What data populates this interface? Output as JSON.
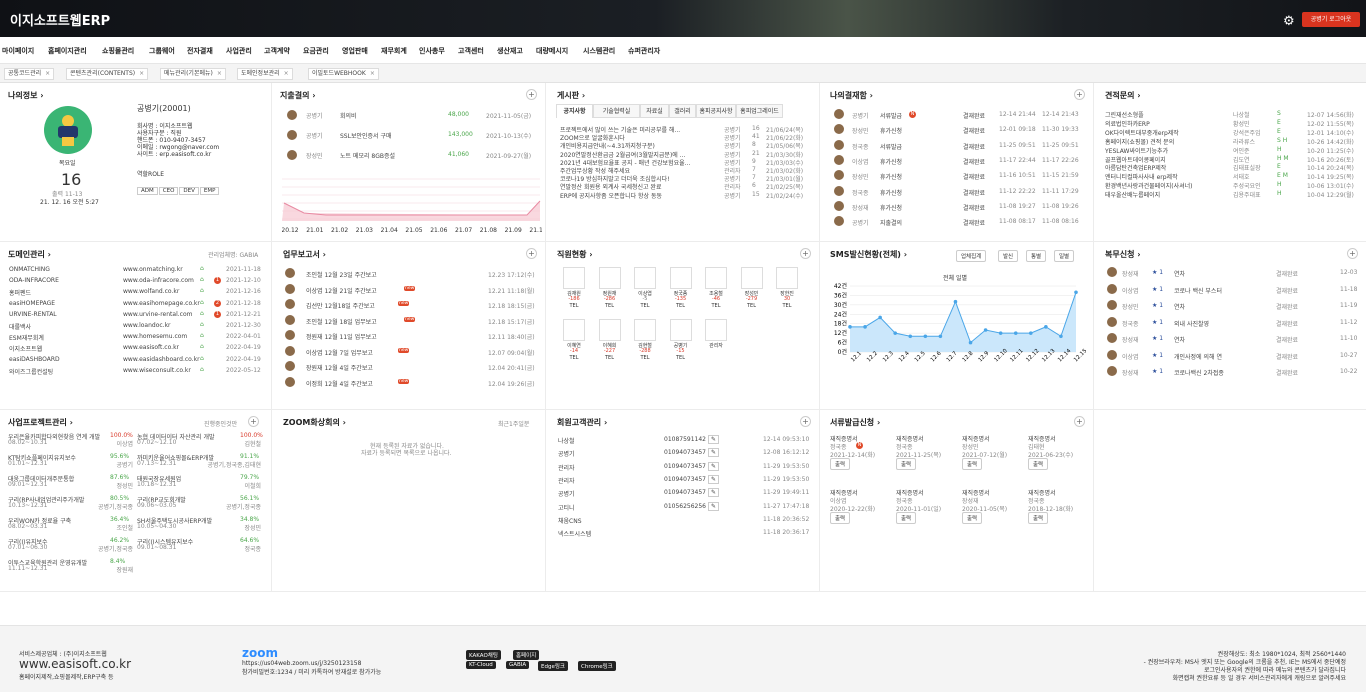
{
  "header": {
    "logo": "이지소프트웹ERP",
    "logout": "공병기 로그아웃"
  },
  "menu": [
    "마이페이지",
    "홈페이지관리",
    "쇼핑몰관리",
    "그룹웨어",
    "전자결재",
    "사업관리",
    "고객계약",
    "요금관리",
    "영업판매",
    "재무회계",
    "인사총무",
    "고객센터",
    "생산재고",
    "대량메시지",
    "시스템관리",
    "슈퍼관리자"
  ],
  "tabs": [
    "공통코드관리",
    "콘텐츠관리(CONTENTS)",
    "메뉴관리(기본메뉴)",
    "도메인정보관리",
    "이밀토드WEBHOOK"
  ],
  "myinfo": {
    "title": "나의정보",
    "name": "공병기(20001)",
    "dept_line": "회사명 : 이지소프트웹",
    "rank": "사용자구분 : 직원",
    "phone": "핸드폰 : 010-9407-3457",
    "email": "이메일 : rwgong@naver.com",
    "site": "사이트 : erp.easisoft.co.kr",
    "weekday": "목요일",
    "day": "16",
    "login_date": "출력 11-13",
    "login_time": "21. 12. 16 오전 5:27",
    "role_label": "역할ROLE",
    "roles": [
      "ADM",
      "CEO",
      "DEV",
      "EMP"
    ]
  },
  "expense": {
    "title": "지출결의",
    "rows": [
      {
        "name": "공병기",
        "desc": "회의비",
        "amount": "48,000",
        "date": "2021-11-05(금)"
      },
      {
        "name": "공병기",
        "desc": "SSL보안인증서 구매",
        "amount": "143,000",
        "date": "2021-10-13(수)"
      },
      {
        "name": "장성민",
        "desc": "노트 메모리 8GB증설",
        "amount": "41,060",
        "date": "2021-09-27(월)"
      }
    ],
    "xlabels": [
      "20.12",
      "21.01",
      "21.02",
      "21.03",
      "21.04",
      "21.05",
      "21.06",
      "21.07",
      "21.08",
      "21.09",
      "21.10"
    ]
  },
  "board": {
    "title": "게시판",
    "tabs": [
      "공지사항",
      "기술협력실",
      "자료실",
      "갤러리",
      "홈피공지사항",
      "홈피업그레이드"
    ],
    "rows": [
      {
        "t": "프로젝트에서 많이 쓰는 기술은 미리공부를 해...",
        "n": "공병기",
        "c": "16",
        "d": "21/06/24(목)"
      },
      {
        "t": "ZOOM으로 얼굴화훈시다",
        "n": "공병기",
        "c": "41",
        "d": "21/06/22(화)"
      },
      {
        "t": "개인비용지급안내(~4.31까지청구분)",
        "n": "공병기",
        "c": "8",
        "d": "21/05/06(목)"
      },
      {
        "t": "2020연말정산환급금 2월급여(3월말지급분)에 ...",
        "n": "공병기",
        "c": "21",
        "d": "21/03/30(화)"
      },
      {
        "t": "2021년 4대보험요율표 공지 - 매년 건강보험요율...",
        "n": "공병기",
        "c": "9",
        "d": "21/03/03(수)"
      },
      {
        "t": "주간업무상황 작성 해주세요",
        "n": "관리자",
        "c": "7",
        "d": "21/03/02(화)"
      },
      {
        "t": "코로나19 방심하지말고 더더욱 조심합시다!",
        "n": "공병기",
        "c": "7",
        "d": "21/03/01(월)"
      },
      {
        "t": "연말정산 회원용 외계사 국세청신고 완료",
        "n": "관리자",
        "c": "6",
        "d": "21/02/25(목)"
      },
      {
        "t": "ERP에 공지사항좀 오픈합니다 항상 동동",
        "n": "공병기",
        "c": "15",
        "d": "21/02/24(수)"
      }
    ]
  },
  "approval": {
    "title": "나의결재함",
    "rows": [
      {
        "n": "공병기",
        "k": "서류발급",
        "s": "결재완료",
        "d1": "12-14 21:44",
        "d2": "12-14 21:43",
        "badge": "N"
      },
      {
        "n": "장성민",
        "k": "휴가신청",
        "s": "결재완료",
        "d1": "12-01 09:18",
        "d2": "11-30 19:33"
      },
      {
        "n": "정국종",
        "k": "서류발급",
        "s": "결재완료",
        "d1": "11-25 09:51",
        "d2": "11-25 09:51"
      },
      {
        "n": "이상엽",
        "k": "휴가신청",
        "s": "결재완료",
        "d1": "11-17 22:44",
        "d2": "11-17 22:26"
      },
      {
        "n": "장성민",
        "k": "휴가신청",
        "s": "결재완료",
        "d1": "11-16 10:51",
        "d2": "11-15 21:59"
      },
      {
        "n": "정국종",
        "k": "휴가신청",
        "s": "결재완료",
        "d1": "11-12 22:22",
        "d2": "11-11 17:29"
      },
      {
        "n": "장성재",
        "k": "휴가신청",
        "s": "결재완료",
        "d1": "11-08 19:27",
        "d2": "11-08 19:26"
      },
      {
        "n": "공병기",
        "k": "지출결의",
        "s": "결재완료",
        "d1": "11-08 08:17",
        "d2": "11-08 08:16"
      }
    ]
  },
  "estimate": {
    "title": "견적문의",
    "rows": [
      {
        "t": "그린재선소형플",
        "n": "나상철",
        "s": "S",
        "d": "12-07 14:56(화)"
      },
      {
        "t": "의료법인하카ERP",
        "n": "황성민",
        "s": "E",
        "d": "12-02 11:55(목)"
      },
      {
        "t": "OK다이렉트대부중개erp제작",
        "n": "강석은주임",
        "s": "E",
        "d": "12-01 14:10(수)"
      },
      {
        "t": "홈페이지(쇼핑몰) 견적 문의",
        "n": "라라류스",
        "s": "S H",
        "d": "10-26 14:42(화)"
      },
      {
        "t": "YESLAW싸이트기능추가",
        "n": "여인준",
        "s": "H",
        "d": "10-20 11:25(수)"
      },
      {
        "t": "골프웹아트데이콩페이지",
        "n": "김도연",
        "s": "H M",
        "d": "10-16 20:26(토)"
      },
      {
        "t": "아름답탄건축업ERP제작",
        "n": "김태표실장",
        "s": "E",
        "d": "10-14 20:24(목)"
      },
      {
        "t": "엔터니티컬파사사내 erp제작",
        "n": "서태호",
        "s": "E M",
        "d": "10-14 19:25(목)"
      },
      {
        "t": "환경백년사랑과건물페이지(사셔너)",
        "n": "주성국요인",
        "s": "H",
        "d": "10-06 13:01(수)"
      },
      {
        "t": "태우올산배누룹페이지",
        "n": "김용주대표",
        "s": "H",
        "d": "10-04 12:29(월)"
      }
    ]
  },
  "domain": {
    "title": "도메인관리",
    "note": "관리업체명: GABIA",
    "rows": [
      {
        "n": "ONMATCHING",
        "u": "www.onmatching.kr",
        "d": "2021-11-18"
      },
      {
        "n": "ODA-INFRACORE",
        "u": "www.oda-infracore.com",
        "d": "2021-12-10",
        "b": "1"
      },
      {
        "n": "홍퍼펜드",
        "u": "www.wolfand.co.kr",
        "d": "2021-12-16"
      },
      {
        "n": "easiHOMEPAGE",
        "u": "www.easihomepage.co.kr",
        "d": "2021-12-18",
        "b": "2"
      },
      {
        "n": "URVINE-RENTAL",
        "u": "www.urvine-rental.com",
        "d": "2021-12-21",
        "b": "1"
      },
      {
        "n": "대룰백사",
        "u": "www.loandoc.kr",
        "d": "2021-12-30"
      },
      {
        "n": "ESM재무회계",
        "u": "www.homesemu.com",
        "d": "2022-04-01"
      },
      {
        "n": "이지소프트웹",
        "u": "www.easisoft.co.kr",
        "d": "2022-04-19"
      },
      {
        "n": "easiDASHBOARD",
        "u": "www.easidashboard.co.kr",
        "d": "2022-04-19"
      },
      {
        "n": "와이즈그룹컨설팅",
        "u": "www.wiseconsult.co.kr",
        "d": "2022-05-12"
      }
    ]
  },
  "weekly": {
    "title": "업무보고서",
    "rows": [
      {
        "t": "조인철 12월 23일 주간보고",
        "d": "12.23 17:12(수)"
      },
      {
        "t": "이상엽 12월 21일 주간보고",
        "d": "12.21 11:18(월)",
        "b": "new"
      },
      {
        "t": "김선만 12월18일 주간보고",
        "d": "12.18 18:15(금)",
        "b": "new"
      },
      {
        "t": "조인철 12월 18일 업무보고",
        "d": "12.18 15:17(금)",
        "b": "new"
      },
      {
        "t": "정원재 12월 11일 업무보고",
        "d": "12.11 18:40(금)"
      },
      {
        "t": "이상엽 12월 7일 업무보고",
        "d": "12.07 09:04(월)",
        "b": "new"
      },
      {
        "t": "장원재 12월 4일 주간보고",
        "d": "12.04 20:41(금)"
      },
      {
        "t": "이정희 12월 4일 주간보고",
        "d": "12.04 19:26(금)",
        "b": "new"
      }
    ]
  },
  "staff": {
    "title": "직원현황",
    "row1": [
      {
        "n": "김재원",
        "v": "-186"
      },
      {
        "n": "정원재",
        "v": "-286"
      },
      {
        "n": "이상엽",
        "v": "-5"
      },
      {
        "n": "정국종",
        "v": "-135"
      },
      {
        "n": "조용철",
        "v": "-46"
      },
      {
        "n": "장성민",
        "v": "-279"
      },
      {
        "n": "장한진",
        "v": "30"
      }
    ],
    "row2": [
      {
        "n": "이혜연",
        "v": "-14"
      },
      {
        "n": "이혜희",
        "v": "-227"
      },
      {
        "n": "김현철",
        "v": "-288"
      },
      {
        "n": "공병기",
        "v": "-15"
      },
      {
        "n": "관리자",
        "v": ""
      }
    ],
    "tel": "TEL"
  },
  "sms": {
    "title": "SMS발신현황(전체)",
    "buttons": [
      "업체집계",
      "발신",
      "통별",
      "일별"
    ],
    "chart_title": "전체 일별",
    "yticks": [
      "42건",
      "36건",
      "30건",
      "24건",
      "18건",
      "12건",
      "6건",
      "0건"
    ]
  },
  "leave": {
    "title": "복무신청",
    "rows": [
      {
        "n": "장성재",
        "k": "연차",
        "s": "결재완료",
        "d": "12-03"
      },
      {
        "n": "이상엽",
        "k": "코로나 백신 부스터",
        "s": "결재완료",
        "d": "11-18"
      },
      {
        "n": "장성민",
        "k": "연차",
        "s": "결재완료",
        "d": "11-19"
      },
      {
        "n": "정국종",
        "k": "외내 사진찰영",
        "s": "결재완료",
        "d": "11-12"
      },
      {
        "n": "장성재",
        "k": "연차",
        "s": "결재완료",
        "d": "11-10"
      },
      {
        "n": "이상엽",
        "k": "개인사정에 의해 연",
        "s": "결재완료",
        "d": "10-27"
      },
      {
        "n": "장성재",
        "k": "코로나백신 2차접종",
        "s": "결재완료",
        "d": "10-22"
      }
    ]
  },
  "project": {
    "title": "사업프로젝트관리",
    "note": "진행중인것만",
    "rows": [
      {
        "a": "우리은율카피합다외현찾음 연계 개발",
        "ap": "100.0%",
        "ad": "08.02~10.31",
        "an": "이상엽",
        "b": "농협 데이터이터 자산관리 개발",
        "bp": "100.0%",
        "bd": "07.02~12.10",
        "bn": "김현철"
      },
      {
        "a": "KT탐키쇼플페이지유지보수",
        "ap": "95.6%",
        "ad": "01.01~12.31",
        "an": "공병기",
        "b": "까미키운율어쇼핑몰&ERP개발",
        "bp": "91.1%",
        "bd": "07.13~12.31",
        "bn": "공병기,정국종,김태현"
      },
      {
        "a": "대웅그룹데이터개주문통합",
        "ap": "87.6%",
        "ad": "09.01~12.31",
        "an": "정성민",
        "b": "태원국장유세원업",
        "bp": "79.7%",
        "bd": "10.18~12.31",
        "bn": "이철희"
      },
      {
        "a": "구리(RP사내업업관리주가개발",
        "ap": "80.5%",
        "ad": "10.13~12.31",
        "an": "공병기,정국종",
        "b": "구리(RP교도회개발",
        "bp": "56.1%",
        "bd": "09.06~03.05",
        "bn": "공병기,정국종"
      },
      {
        "a": "우리WON카 정료율 구축",
        "ap": "36.4%",
        "ad": "08.02~03.31",
        "an": "조인철",
        "b": "SH서울주택도시공사ERP개발",
        "bp": "34.8%",
        "bd": "10.05~04.30",
        "bn": "장성민"
      },
      {
        "a": "구리(I)유지보수",
        "ap": "46.2%",
        "ad": "07.01~06.30",
        "an": "공병기,정국종",
        "b": "구리(I)시스템유지보수",
        "bp": "64.6%",
        "bd": "09.01~08.31",
        "bn": "정국종"
      },
      {
        "a": "이투스교육학원관리 운영유개발",
        "ap": "8.4%",
        "ad": "11.11~12.31",
        "an": "장원재",
        "b": "",
        "bp": "",
        "bd": "",
        "bn": ""
      }
    ]
  },
  "zoom": {
    "title": "ZOOM화상회의",
    "note": "최근1주일분",
    "empty1": "현재 등록된 자료가 없습니다.",
    "empty2": "자료가 등록되면 목록으로 나옵니다."
  },
  "members": {
    "title": "회원고객관리",
    "rows": [
      {
        "n": "나상철",
        "p": "01087591142",
        "d": "12-14 09:53:10"
      },
      {
        "n": "공병기",
        "p": "01094073457",
        "d": "12-08 16:12:12"
      },
      {
        "n": "관리자",
        "p": "01094073457",
        "d": "11-29 19:53:50"
      },
      {
        "n": "관리자",
        "p": "01094073457",
        "d": "11-29 19:53:50"
      },
      {
        "n": "공병기",
        "p": "01094073457",
        "d": "11-29 19:49:11"
      },
      {
        "n": "고티니",
        "p": "01056256256",
        "d": "11-27 17:47:18"
      },
      {
        "n": "채움CNS",
        "p": "",
        "d": "11-18 20:36:52"
      },
      {
        "n": "넥스트시스템",
        "p": "",
        "d": "11-18 20:36:17"
      }
    ]
  },
  "docs": {
    "title": "서류발급신청",
    "items": [
      {
        "k": "재직증명서",
        "n": "정국종",
        "d": "2021-12-14(화)",
        "b": "N",
        "btn": "출력"
      },
      {
        "k": "재직증명서",
        "n": "정국종",
        "d": "2021-11-25(목)",
        "btn": "출력"
      },
      {
        "k": "재직증명서",
        "n": "장성민",
        "d": "2021-07-12(월)",
        "btn": "출력"
      },
      {
        "k": "재직증명서",
        "n": "김태현",
        "d": "2021-06-23(수)",
        "btn": "출력"
      },
      {
        "k": "재직증명서",
        "n": "이상엽",
        "d": "2020-12-22(화)",
        "btn": "출력"
      },
      {
        "k": "재직증명서",
        "n": "정국종",
        "d": "2020-11-01(일)",
        "btn": "출력"
      },
      {
        "k": "재직증명서",
        "n": "장성재",
        "d": "2020-11-05(목)",
        "btn": "출력"
      },
      {
        "k": "재직증명서",
        "n": "정국종",
        "d": "2018-12-18(화)",
        "btn": "출력"
      }
    ]
  },
  "footer": {
    "company": "서비스제공업체 : (주)이지소프트웹",
    "site": "www.easisoft.co.kr",
    "sub": "홈페이지제작,쇼핑몰제작,ERP구축 등",
    "zoom": "zoom",
    "zoom_url": "https://us04web.zoom.us/j/3250123158",
    "zoom_pw": "참가비밀번호:1234 / 미리 카톡하여 방재설로 참가가능",
    "pills": [
      "KAKAO채팅",
      "홈페이지",
      "KT-Cloud",
      "GABIA",
      "Edge링크",
      "Chrome링크"
    ],
    "right1": "권장해상도: 최소 1980*1024, 최적 2560*1440",
    "right2": "- 권장브라우저: MS사 엣지 또는 Google의 크롬을 추천, IE는 MS에서 중단예정",
    "right3": "로그인사용자의 권한에 따라 메뉴와 콘텐츠가 달라집니다",
    "right4": "화면캡쳐 권한요류 등 일 경우 서비스관리자에게 캐링으로 알려주세요"
  }
}
